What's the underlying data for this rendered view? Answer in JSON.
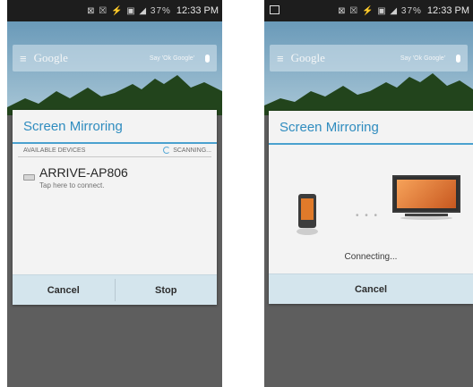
{
  "status_bar": {
    "icons": "⊠ ☒ ⚡ ▣ ◢ 37%",
    "time": "12:33 PM"
  },
  "search_bar": {
    "brand": "Google",
    "hint": "Say 'Ok Google'"
  },
  "left_dialog": {
    "title": "Screen Mirroring",
    "available_label": "AVAILABLE DEVICES",
    "scanning_label": "SCANNING...",
    "device_name": "ARRIVE-AP806",
    "device_hint": "Tap here to connect.",
    "cancel_label": "Cancel",
    "stop_label": "Stop"
  },
  "right_dialog": {
    "title": "Screen Mirroring",
    "status": "Connecting...",
    "cancel_label": "Cancel"
  },
  "colors": {
    "accent": "#2f8cbf",
    "button_bar": "#d4e5ed"
  }
}
